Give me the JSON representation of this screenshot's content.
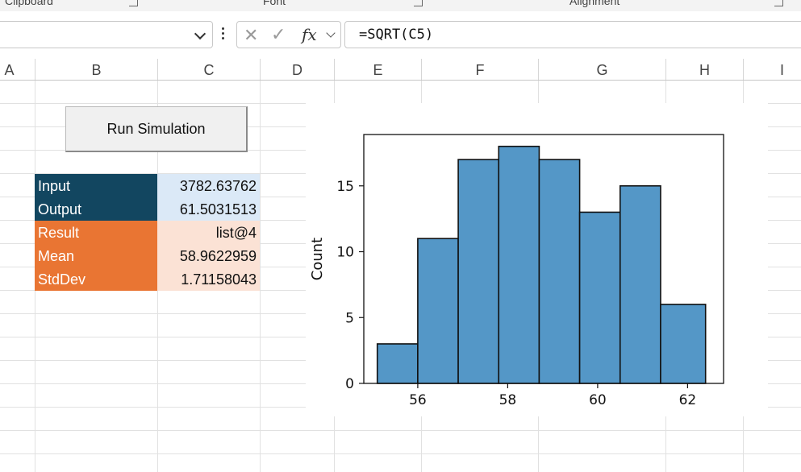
{
  "ribbon": {
    "groups": [
      {
        "label": "Clipboard",
        "launcher": "dialog-launcher-icon"
      },
      {
        "label": "Font",
        "launcher": "dialog-launcher-icon"
      },
      {
        "label": "Alignment",
        "launcher": "dialog-launcher-icon"
      }
    ]
  },
  "formula_bar": {
    "name_box_value": "",
    "cancel_icon": "x-icon",
    "enter_icon": "check-icon",
    "fx_label": "fx",
    "formula": "=SQRT(C5)"
  },
  "columns": [
    "A",
    "B",
    "C",
    "D",
    "E",
    "F",
    "G",
    "H",
    "I"
  ],
  "button": {
    "label": "Run Simulation"
  },
  "table": [
    {
      "label": "Input",
      "value": "3782.63762"
    },
    {
      "label": "Output",
      "value": "61.5031513"
    },
    {
      "label": "Result",
      "value": "list@4"
    },
    {
      "label": "Mean",
      "value": "58.9622959"
    },
    {
      "label": "StdDev",
      "value": "1.71158043"
    }
  ],
  "colors": {
    "header_navy": "#124660",
    "value_blue": "#dbe9f7",
    "header_orange": "#e97533",
    "value_peach": "#fbe2d5",
    "bar_fill": "#5497c7"
  },
  "chart_data": {
    "type": "bar",
    "title": "",
    "xlabel": "",
    "ylabel": "Count",
    "bin_edges": [
      55.1,
      56.0,
      56.9,
      57.8,
      58.7,
      59.6,
      60.5,
      61.4,
      62.4
    ],
    "values": [
      3,
      11,
      17,
      18,
      17,
      13,
      15,
      6
    ],
    "xticks": [
      56,
      58,
      60,
      62
    ],
    "yticks": [
      0,
      5,
      10,
      15
    ],
    "xlim": [
      54.8,
      62.8
    ],
    "ylim": [
      0,
      18.9
    ],
    "grid": false,
    "legend": "none"
  }
}
